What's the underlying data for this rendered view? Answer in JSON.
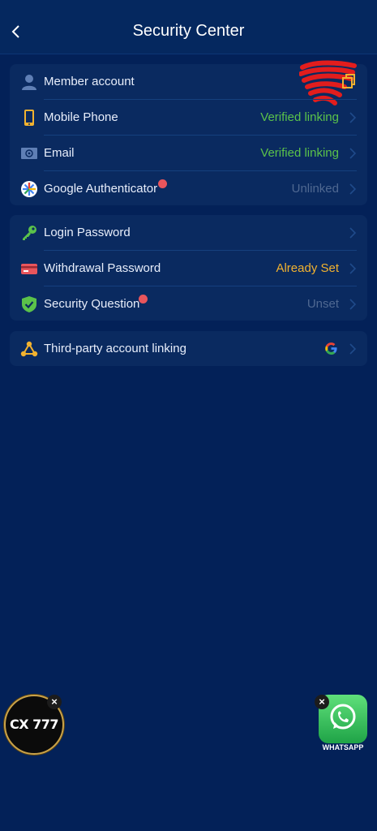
{
  "header": {
    "title": "Security Center",
    "back_icon": "chevron-left-icon"
  },
  "account_section": {
    "items": [
      {
        "label": "Member account",
        "value": "",
        "icon": "user-icon"
      },
      {
        "label": "Mobile Phone",
        "value": "Verified linking",
        "icon": "phone-icon"
      },
      {
        "label": "Email",
        "value": "Verified linking",
        "icon": "email-icon"
      },
      {
        "label": "Google Authenticator",
        "value": "Unlinked",
        "icon": "google-authenticator-icon"
      }
    ]
  },
  "password_section": {
    "items": [
      {
        "label": "Login Password",
        "value": "",
        "icon": "key-icon"
      },
      {
        "label": "Withdrawal Password",
        "value": "Already Set",
        "icon": "credit-card-icon"
      },
      {
        "label": "Security Question",
        "value": "Unset",
        "icon": "shield-check-icon"
      }
    ]
  },
  "third_party": {
    "label": "Third-party account linking",
    "icon": "share-nodes-icon",
    "provider_icon": "google-logo-icon"
  },
  "floating": {
    "cx777": {
      "logo_text": "CX 777",
      "close": "×"
    },
    "whatsapp": {
      "label": "WHATSAPP",
      "close": "×"
    }
  },
  "colors": {
    "background": "#032158",
    "card": "#0a2a60",
    "verified": "#5bc24a",
    "unset": "#4f6891",
    "already_set": "#f2b22f",
    "notification_dot": "#e8555c"
  }
}
